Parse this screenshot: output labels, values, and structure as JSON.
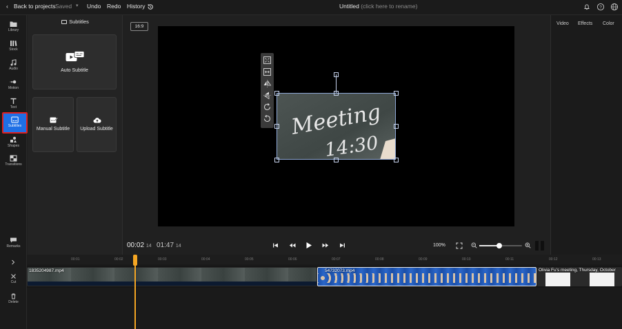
{
  "topbar": {
    "back": "Back to projects",
    "saved": "Saved",
    "undo": "Undo",
    "redo": "Redo",
    "history": "History",
    "title": "Untitled",
    "rename_hint": "(click here to rename)"
  },
  "rail": {
    "library": "Library",
    "stock": "Stock",
    "audio": "Audio",
    "motion": "Motion",
    "text": "Text",
    "subtitles": "Subtitles",
    "shapes": "Shapes",
    "transitions": "Transitions",
    "remarks": "Remarks"
  },
  "panel": {
    "title": "Subtitles",
    "auto": "Auto Subtitle",
    "manual": "Manual Subtitle",
    "upload": "Upload Subtitle"
  },
  "preview": {
    "ratio": "16:9",
    "chalk_line1": "Meeting",
    "chalk_line2": "14:30"
  },
  "transport": {
    "current": "00:02",
    "current_frames": "14",
    "total": "01:47",
    "total_frames": "14",
    "zoom": "100%"
  },
  "right_tabs": [
    "Video",
    "Effects",
    "Color"
  ],
  "timeline": {
    "ticks": [
      "00:01",
      "00:02",
      "00:03",
      "00:04",
      "00:05",
      "00:06",
      "00:07",
      "00:08",
      "00:09",
      "00:10",
      "00:11",
      "00:12",
      "00:13"
    ],
    "clip1_name": "1835204987.mp4",
    "clip2_name": "54732073.mp4",
    "clip3_name": "Olivia Fu's meeting, Thursday, October",
    "cut": "Cut",
    "delete": "Delete"
  },
  "colors": {
    "accent": "#1f6fe5",
    "highlight": "#e02020",
    "playhead": "#f5a623"
  }
}
